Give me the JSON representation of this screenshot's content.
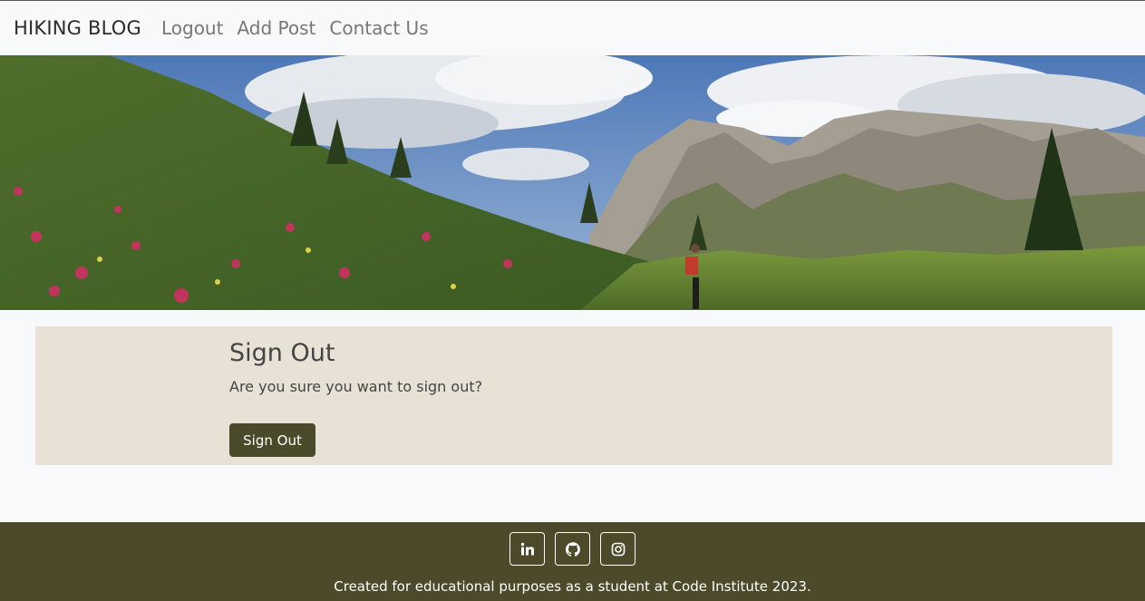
{
  "navbar": {
    "brand": "HIKING BLOG",
    "links": [
      "Logout",
      "Add Post",
      "Contact Us"
    ]
  },
  "hero": {
    "image": "mountain-meadow-hiker-photo"
  },
  "signout": {
    "title": "Sign Out",
    "message": "Are you sure you want to sign out?",
    "button_label": "Sign Out"
  },
  "footer": {
    "social_icons": [
      "linkedin-icon",
      "github-icon",
      "instagram-icon"
    ],
    "text": "Created for educational purposes as a student at Code Institute 2023."
  },
  "colors": {
    "card_background": "#e8e1d6",
    "button_background": "#4a4a2a",
    "footer_background": "#4c4a2a",
    "page_background": "#f8f9fa"
  }
}
